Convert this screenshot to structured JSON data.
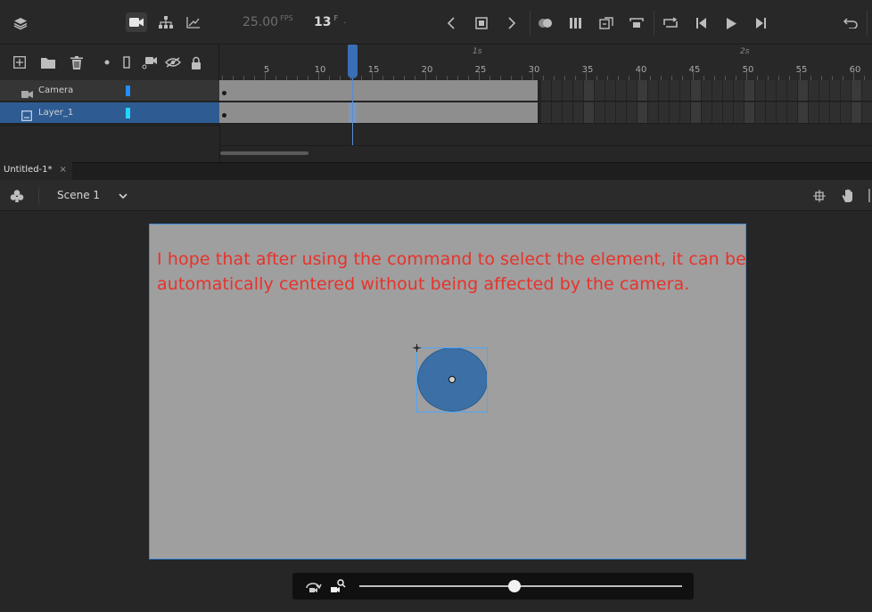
{
  "toolbar": {
    "fps_value": "25.00",
    "fps_unit": "FPS",
    "frame_value": "13",
    "frame_unit": "F",
    "frame_dot": "·"
  },
  "ruler": {
    "numbers": [
      "5",
      "10",
      "15",
      "20",
      "25",
      "30",
      "35",
      "40",
      "45",
      "50",
      "55",
      "60"
    ],
    "seconds": [
      "1s",
      "2s"
    ]
  },
  "layers": [
    {
      "name": "Camera",
      "icon": "camera-icon",
      "color": "#1f8fff",
      "selected": false
    },
    {
      "name": "Layer_1",
      "icon": "layer-icon",
      "color": "#22d7ff",
      "selected": true
    }
  ],
  "document": {
    "tab_label": "Untitled-1*",
    "close_label": "×"
  },
  "scene": {
    "label": "Scene 1"
  },
  "stage": {
    "text_line1": "I hope that after using the command to select the element, it can be",
    "text_line2": "automatically centered without being affected by the camera.",
    "text_color": "#e8322a",
    "background_color": "#9f9f9f",
    "object_color": "#3b6fa5"
  },
  "camera_bar": {
    "zoom_level": 0.48
  },
  "colors": {
    "accent": "#3a6eb5",
    "selection": "#49a6ff",
    "panel": "#282828"
  }
}
